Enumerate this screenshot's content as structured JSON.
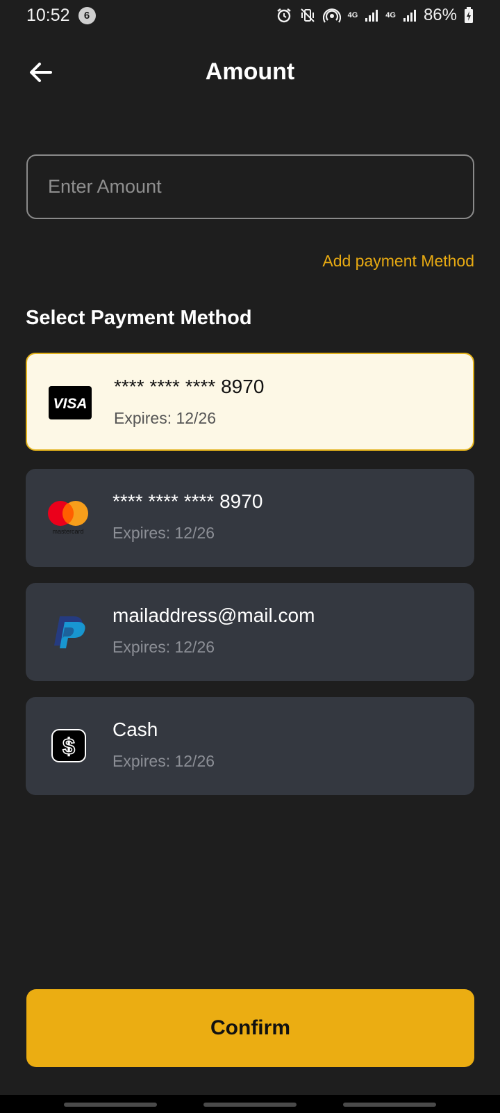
{
  "status_bar": {
    "time": "10:52",
    "notification_count": "6",
    "network_1": "4G",
    "network_2": "4G",
    "battery": "86%"
  },
  "header": {
    "title": "Amount",
    "back_icon": "arrow-left-icon"
  },
  "amount_input": {
    "value": "",
    "placeholder": "Enter Amount"
  },
  "add_payment_label": "Add payment Method",
  "section_title": "Select Payment Method",
  "payment_methods": [
    {
      "logo": "visa-logo",
      "line1": "**** **** **** 8970",
      "line2": "Expires: 12/26",
      "selected": true
    },
    {
      "logo": "mastercard-logo",
      "line1": "**** **** **** 8970",
      "line2": "Expires: 12/26",
      "selected": false
    },
    {
      "logo": "paypal-logo",
      "line1": "mailaddress@mail.com",
      "line2": "Expires: 12/26",
      "selected": false
    },
    {
      "logo": "cash-icon",
      "line1": "Cash",
      "line2": "Expires: 12/26",
      "selected": false
    }
  ],
  "confirm_label": "Confirm",
  "colors": {
    "background": "#1e1e1e",
    "accent": "#ebad12",
    "card": "#343840",
    "selected_card": "#fdf8e6"
  },
  "logo_text": {
    "visa": "VISA",
    "mastercard": "mastercard"
  }
}
